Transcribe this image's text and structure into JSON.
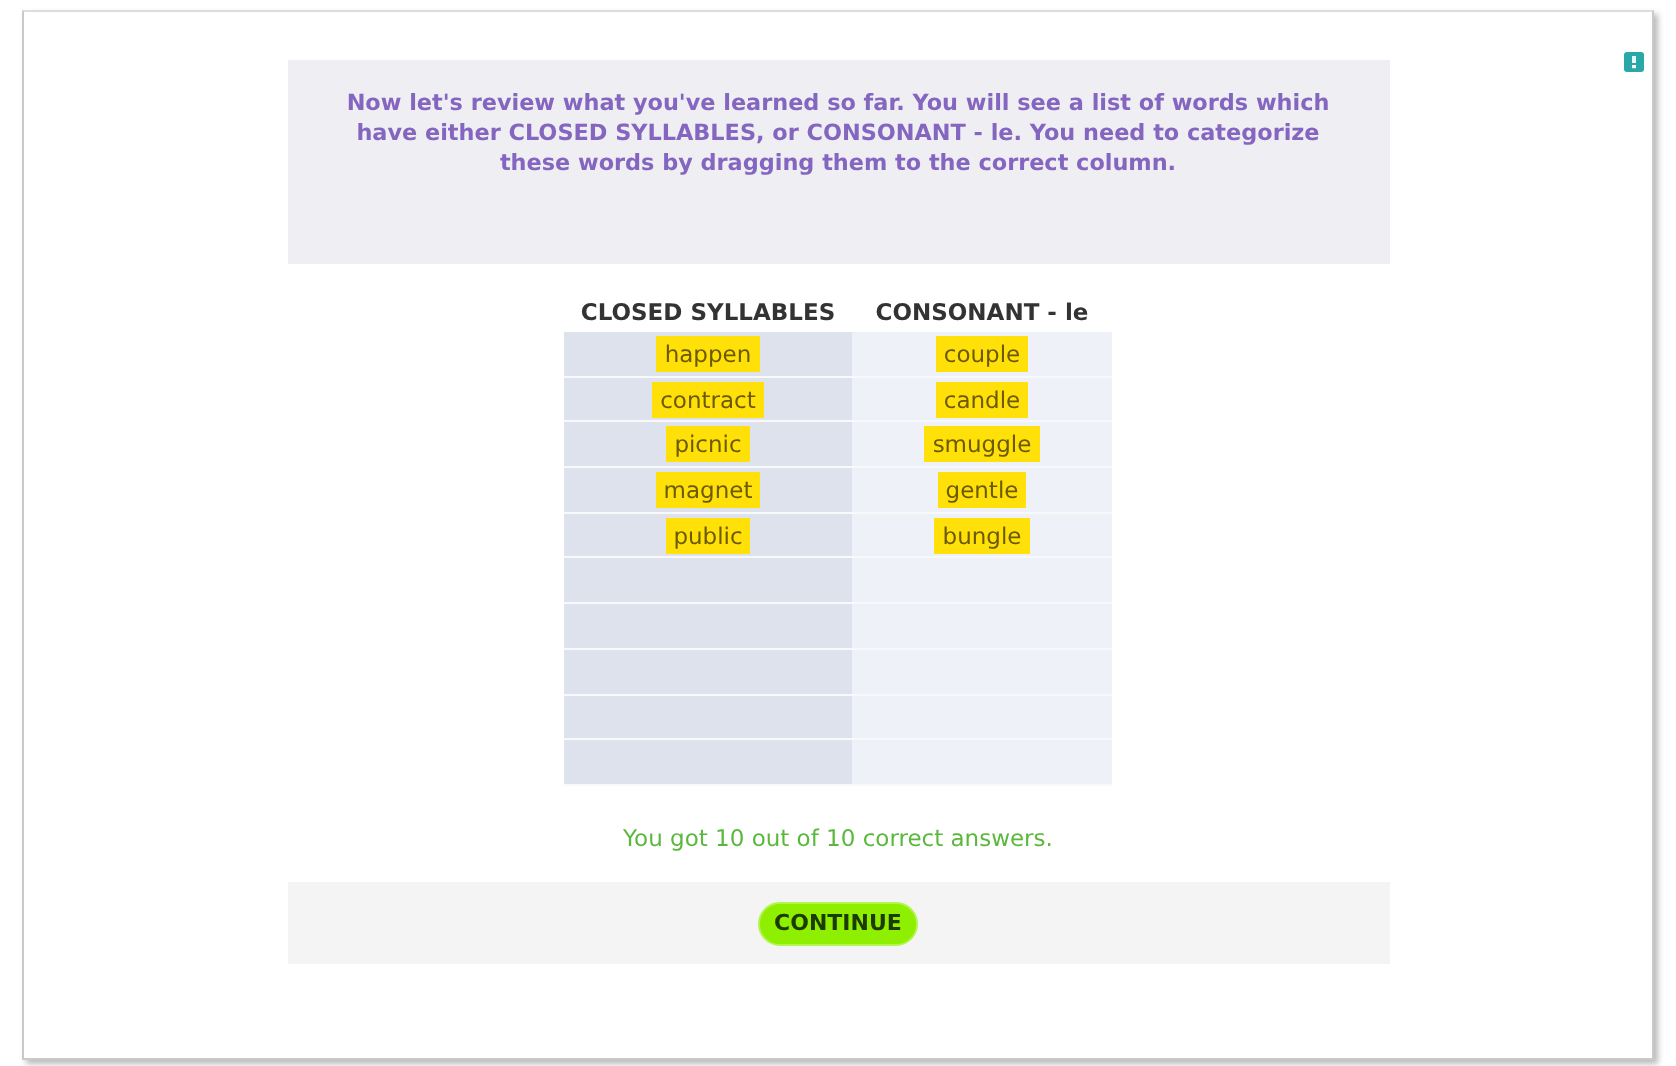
{
  "instructions": "Now let's review what you've learned so far. You will see a list of words which have either CLOSED SYLLABLES, or CONSONANT - le. You need to categorize these words by dragging them to the correct column.",
  "columns": [
    {
      "heading": "CLOSED SYLLABLES",
      "words": [
        "happen",
        "contract",
        "picnic",
        "magnet",
        "public"
      ]
    },
    {
      "heading": "CONSONANT - le",
      "words": [
        "couple",
        "candle",
        "smuggle",
        "gentle",
        "bungle"
      ]
    }
  ],
  "result": "You got 10 out of 10 correct answers.",
  "continue_button": "CONTINUE"
}
